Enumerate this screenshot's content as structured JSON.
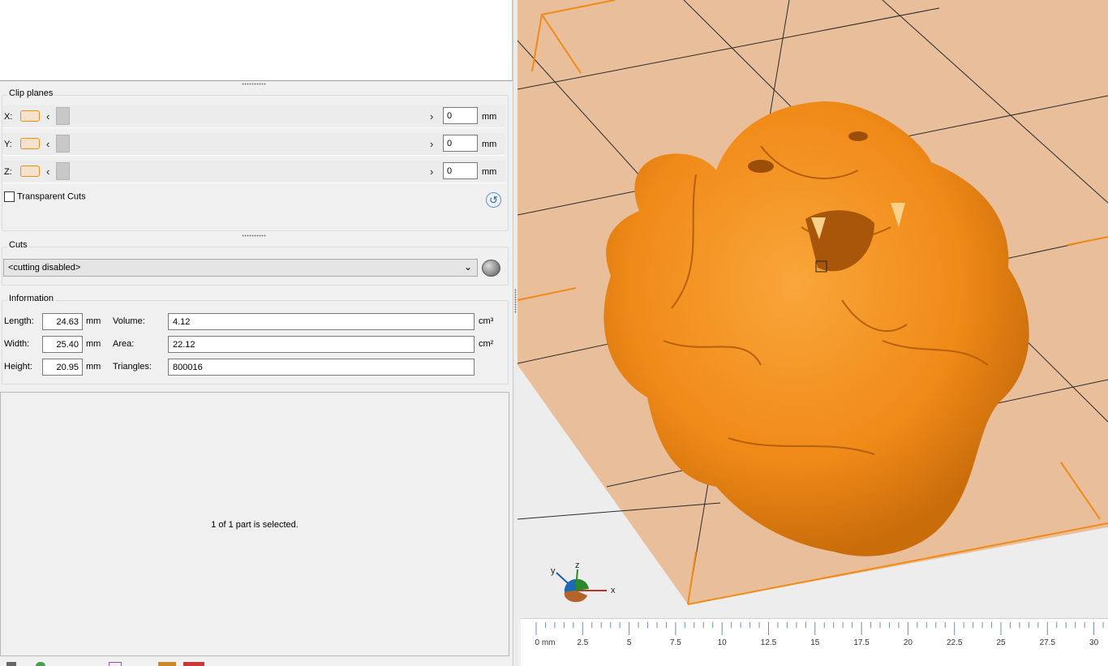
{
  "clip_planes": {
    "title": "Clip planes",
    "unit": "mm",
    "rows": [
      {
        "axis": "X:",
        "value": "0"
      },
      {
        "axis": "Y:",
        "value": "0"
      },
      {
        "axis": "Z:",
        "value": "0"
      }
    ],
    "transparent_cuts_label": "Transparent Cuts"
  },
  "cuts": {
    "title": "Cuts",
    "selected": "<cutting disabled>"
  },
  "information": {
    "title": "Information",
    "length_label": "Length:",
    "length_value": "24.63",
    "width_label": "Width:",
    "width_value": "25.40",
    "height_label": "Height:",
    "height_value": "20.95",
    "dim_unit": "mm",
    "volume_label": "Volume:",
    "volume_value": "4.12",
    "volume_unit": "cm³",
    "area_label": "Area:",
    "area_value": "22.12",
    "area_unit": "cm²",
    "triangles_label": "Triangles:",
    "triangles_value": "800016"
  },
  "status": "1 of 1 part is selected.",
  "axis_gizmo": {
    "y": "y",
    "z": "z",
    "x": "x"
  },
  "ruler": {
    "labels": [
      "0 mm",
      "2.5",
      "5",
      "7.5",
      "10",
      "12.5",
      "15",
      "17.5",
      "20",
      "22.5",
      "25",
      "27.5",
      "30"
    ]
  },
  "colors": {
    "model": "#f28a1c",
    "bed": "#e9bf9b",
    "accent": "#e8901a"
  }
}
